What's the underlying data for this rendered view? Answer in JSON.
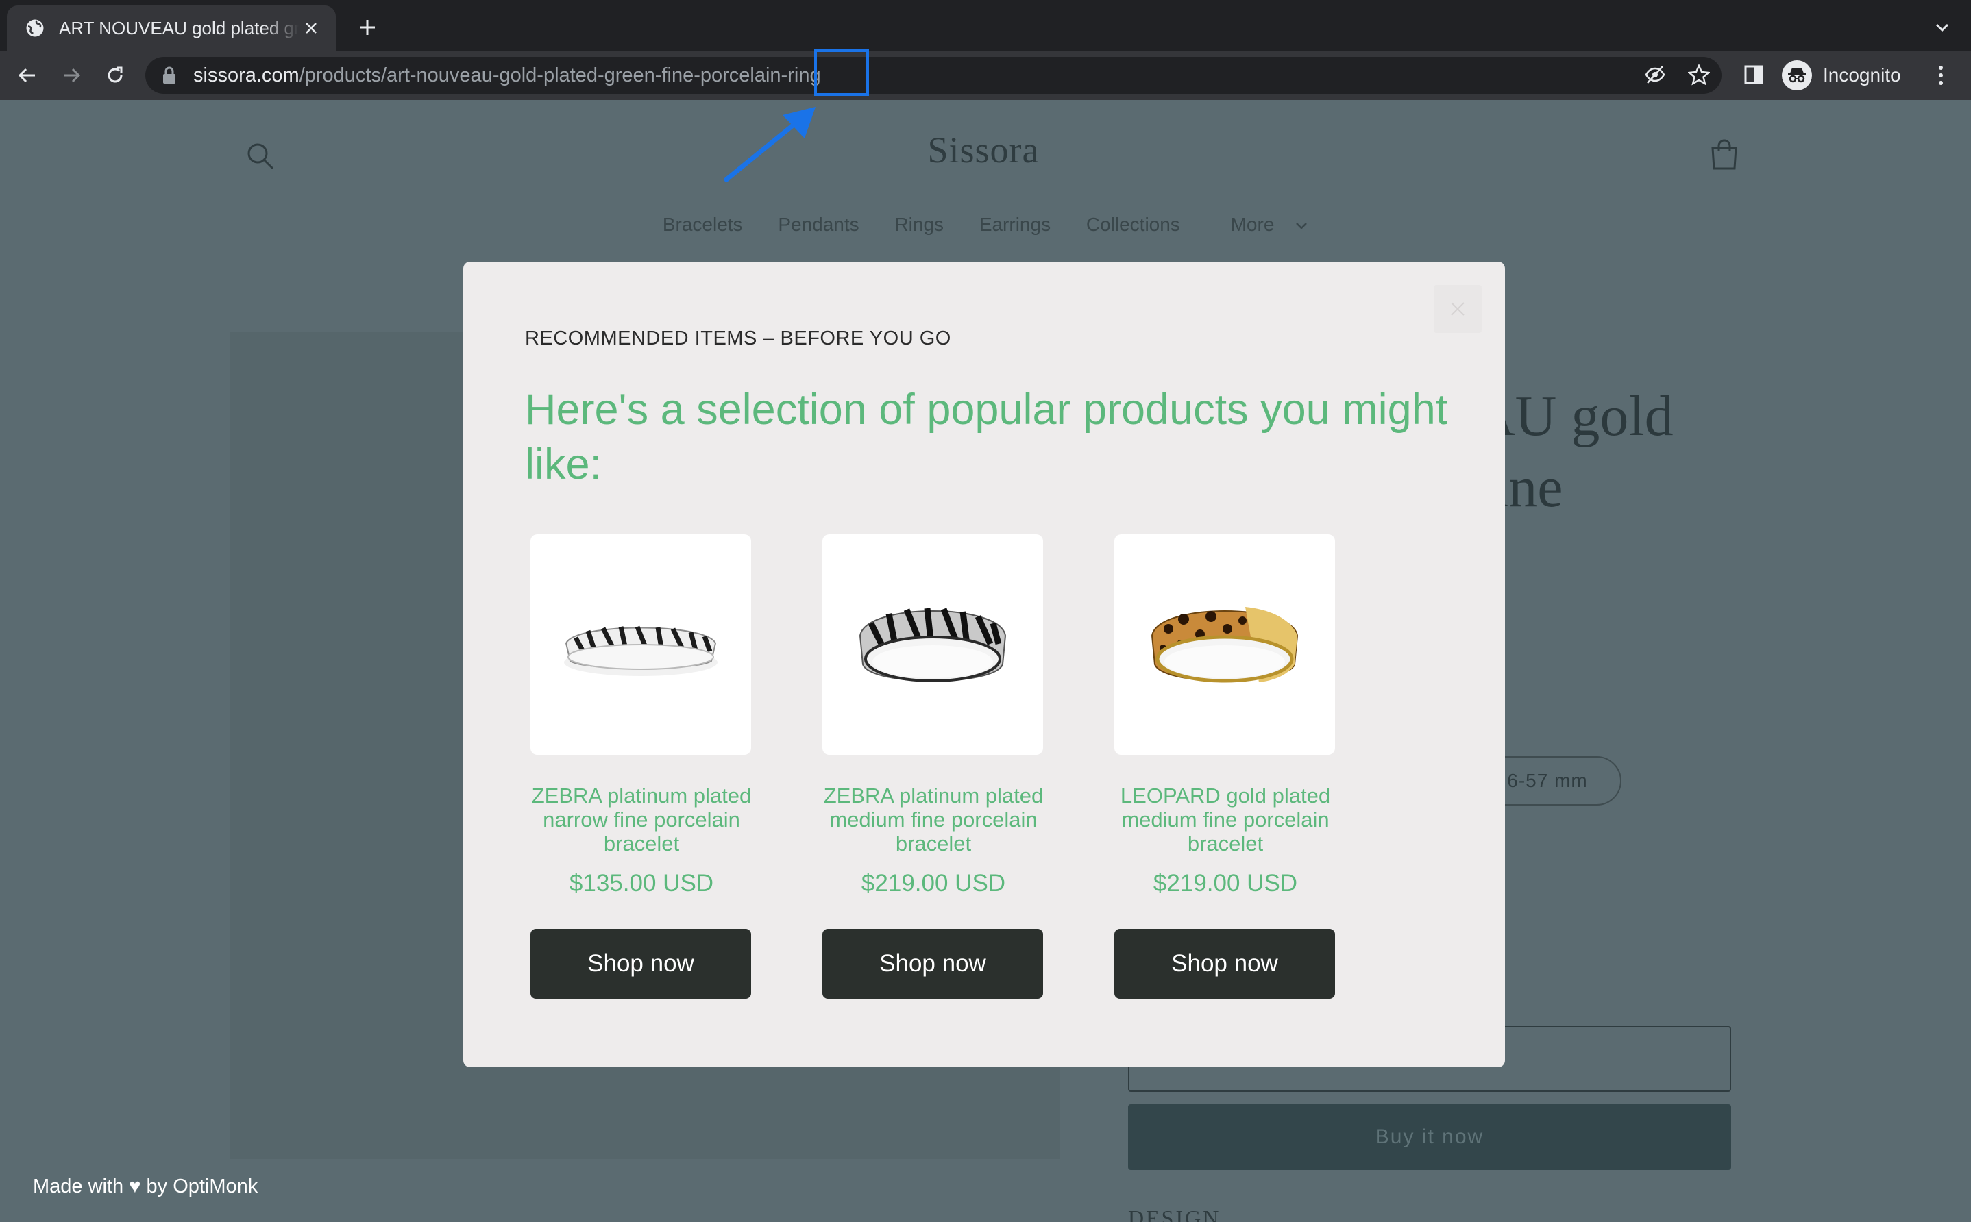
{
  "browser": {
    "tab_title": "ART NOUVEAU gold plated green fine porcelain ring",
    "url_host": "sissora.com",
    "url_path": "/products/art-nouveau-gold-plated-green-fine-porcelain-ring",
    "profile_label": "Incognito",
    "annotation_color": "#1a73e8"
  },
  "site": {
    "logo": "Sissora",
    "nav": [
      "Bracelets",
      "Pendants",
      "Rings",
      "Earrings",
      "Collections",
      "More"
    ],
    "product_title_partial": [
      "AU gold",
      "fine",
      "g"
    ],
    "size_partial": "6-57 mm",
    "buy_now": "Buy it now",
    "design_heading": "DESIGN"
  },
  "popup": {
    "eyebrow": "RECOMMENDED ITEMS – BEFORE YOU GO",
    "headline": "Here's a selection of popular products you might like:",
    "accent_color": "#5cb87c",
    "products": [
      {
        "name": "ZEBRA platinum plated narrow fine porcelain bracelet",
        "price": "$135.00 USD",
        "cta": "Shop now",
        "pattern": "zebra"
      },
      {
        "name": "ZEBRA platinum plated medium fine porcelain bracelet",
        "price": "$219.00 USD",
        "cta": "Shop now",
        "pattern": "zebra"
      },
      {
        "name": "LEOPARD gold plated medium fine porcelain bracelet",
        "price": "$219.00 USD",
        "cta": "Shop now",
        "pattern": "leopard"
      }
    ]
  },
  "footer": {
    "made_with": "Made with ♥ by OptiMonk"
  }
}
